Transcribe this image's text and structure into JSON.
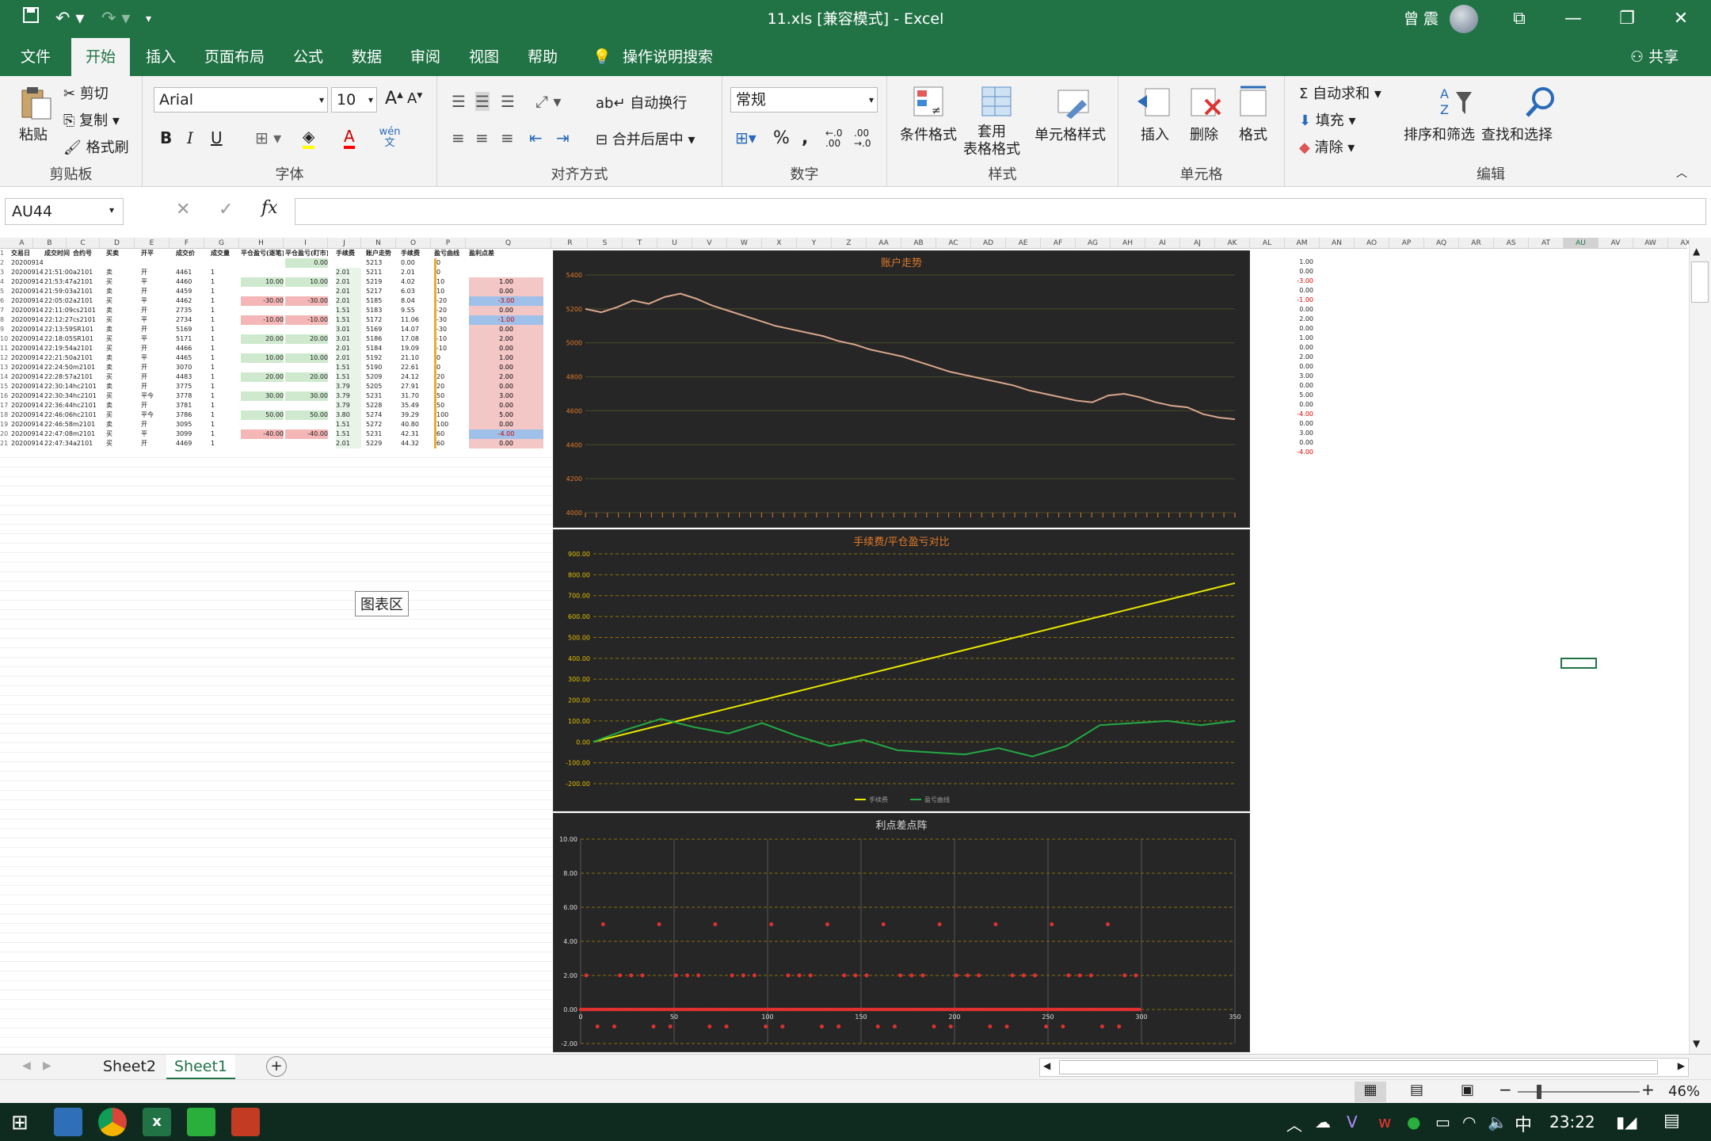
{
  "titlebar": {
    "title": "11.xls  [兼容模式]  -  Excel",
    "user_name": "曾 震",
    "share_label": "共享"
  },
  "tabs": [
    "文件",
    "开始",
    "插入",
    "页面布局",
    "公式",
    "数据",
    "审阅",
    "视图",
    "帮助"
  ],
  "tell_me": "操作说明搜索",
  "ribbon": {
    "clipboard": {
      "paste": "粘贴",
      "cut": "剪切",
      "copy": "复制",
      "format_painter": "格式刷",
      "label": "剪贴板"
    },
    "font": {
      "name": "Arial",
      "size": "10",
      "bold": "B",
      "italic": "I",
      "underline": "U",
      "label": "字体",
      "phonetic": "wén 文"
    },
    "alignment": {
      "wrap": "自动换行",
      "merge": "合并后居中",
      "label": "对齐方式"
    },
    "number": {
      "format": "常规",
      "percent": "%",
      "comma": ",",
      "inc": "←.0 .00",
      "dec": ".00 →.0",
      "label": "数字"
    },
    "styles": {
      "conditional": "条件格式",
      "table": "套用\n表格格式",
      "cell_styles": "单元格样式",
      "label": "样式"
    },
    "cells": {
      "insert": "插入",
      "delete": "删除",
      "format": "格式",
      "label": "单元格"
    },
    "editing": {
      "autosum": "自动求和",
      "fill": "填充",
      "clear": "清除",
      "sort": "排序和筛选",
      "find": "查找和选择",
      "label": "编辑"
    }
  },
  "formula_bar": {
    "name_box": "AU44",
    "fx": "fx",
    "content": ""
  },
  "tooltip": "图表区",
  "columns_left": [
    "A",
    "B",
    "C",
    "D",
    "E",
    "F",
    "G",
    "H",
    "I",
    "J",
    "N",
    "O",
    "P",
    "Q"
  ],
  "columns_right": [
    "R",
    "S",
    "T",
    "U",
    "V",
    "W",
    "X",
    "Y",
    "Z",
    "AA",
    "AB",
    "AC",
    "AD",
    "AE",
    "AF",
    "AG",
    "AH",
    "AI",
    "AJ",
    "AK",
    "AL",
    "AM",
    "AN",
    "AO",
    "AP",
    "AQ",
    "AR",
    "AS",
    "AT",
    "AU",
    "AV",
    "AW",
    "AX"
  ],
  "header_row": [
    "交易日",
    "成交时间",
    "合约号",
    "买卖",
    "开平",
    "成交价",
    "成交量",
    "平仓盈亏(逐笔)",
    "平仓盈亏(盯市)",
    "手续费",
    "账户走势",
    "手续费",
    "盈亏曲线",
    "盈利点差"
  ],
  "rows": [
    [
      "20200914",
      "",
      "",
      "",
      "",
      "",
      "",
      "",
      "0.00",
      "",
      "5213",
      "0.00",
      "0",
      ""
    ],
    [
      "20200914",
      "21:51:00",
      "a2101",
      "卖",
      "开",
      "4461",
      "1",
      "",
      "",
      "2.01",
      "5211",
      "2.01",
      "0",
      ""
    ],
    [
      "20200914",
      "21:53:47",
      "a2101",
      "买",
      "平",
      "4460",
      "1",
      "10.00",
      "10.00",
      "2.01",
      "5219",
      "4.02",
      "10",
      "1.00"
    ],
    [
      "20200914",
      "21:59:03",
      "a2101",
      "卖",
      "开",
      "4459",
      "1",
      "",
      "",
      "2.01",
      "5217",
      "6.03",
      "10",
      "0.00"
    ],
    [
      "20200914",
      "22:05:02",
      "a2101",
      "买",
      "平",
      "4462",
      "1",
      "-30.00",
      "-30.00",
      "2.01",
      "5185",
      "8.04",
      "-20",
      "-3.00"
    ],
    [
      "20200914",
      "22:11:09",
      "cs2101",
      "卖",
      "开",
      "2735",
      "1",
      "",
      "",
      "1.51",
      "5183",
      "9.55",
      "-20",
      "0.00"
    ],
    [
      "20200914",
      "22:12:27",
      "cs2101",
      "买",
      "平",
      "2734",
      "1",
      "-10.00",
      "-10.00",
      "1.51",
      "5172",
      "11.06",
      "-30",
      "-1.00"
    ],
    [
      "20200914",
      "22:13:59",
      "SR101",
      "卖",
      "开",
      "5169",
      "1",
      "",
      "",
      "3.01",
      "5169",
      "14.07",
      "-30",
      "0.00"
    ],
    [
      "20200914",
      "22:18:05",
      "SR101",
      "买",
      "平",
      "5171",
      "1",
      "20.00",
      "20.00",
      "3.01",
      "5186",
      "17.08",
      "-10",
      "2.00"
    ],
    [
      "20200914",
      "22:19:54",
      "a2101",
      "买",
      "开",
      "4466",
      "1",
      "",
      "",
      "2.01",
      "5184",
      "19.09",
      "-10",
      "0.00"
    ],
    [
      "20200914",
      "22:21:50",
      "a2101",
      "卖",
      "平",
      "4465",
      "1",
      "10.00",
      "10.00",
      "2.01",
      "5192",
      "21.10",
      "0",
      "1.00"
    ],
    [
      "20200914",
      "22:24:50",
      "m2101",
      "卖",
      "开",
      "3070",
      "1",
      "",
      "",
      "1.51",
      "5190",
      "22.61",
      "0",
      "0.00"
    ],
    [
      "20200914",
      "22:28:57",
      "a2101",
      "买",
      "开",
      "4483",
      "1",
      "20.00",
      "20.00",
      "1.51",
      "5209",
      "24.12",
      "20",
      "2.00"
    ],
    [
      "20200914",
      "22:30:14",
      "hc2101",
      "卖",
      "开",
      "3775",
      "1",
      "",
      "",
      "3.79",
      "5205",
      "27.91",
      "20",
      "0.00"
    ],
    [
      "20200914",
      "22:30:34",
      "hc2101",
      "买",
      "平今",
      "3778",
      "1",
      "30.00",
      "30.00",
      "3.79",
      "5231",
      "31.70",
      "50",
      "3.00"
    ],
    [
      "20200914",
      "22:36:44",
      "hc2101",
      "卖",
      "开",
      "3781",
      "1",
      "",
      "",
      "3.79",
      "5228",
      "35.49",
      "50",
      "0.00"
    ],
    [
      "20200914",
      "22:46:06",
      "hc2101",
      "买",
      "平今",
      "3786",
      "1",
      "50.00",
      "50.00",
      "3.80",
      "5274",
      "39.29",
      "100",
      "5.00"
    ],
    [
      "20200914",
      "22:46:58",
      "m2101",
      "卖",
      "开",
      "3095",
      "1",
      "",
      "",
      "1.51",
      "5272",
      "40.80",
      "100",
      "0.00"
    ],
    [
      "20200914",
      "22:47:08",
      "m2101",
      "买",
      "平",
      "3099",
      "1",
      "-40.00",
      "-40.00",
      "1.51",
      "5231",
      "42.31",
      "60",
      "-4.00"
    ],
    [
      "20200914",
      "22:47:34",
      "a2101",
      "买",
      "开",
      "4469",
      "1",
      "",
      "",
      "2.01",
      "5229",
      "44.32",
      "60",
      "0.00"
    ]
  ],
  "right_col_AM": [
    "1.00",
    "0.00",
    "-3.00",
    "0.00",
    "-1.00",
    "0.00",
    "2.00",
    "0.00",
    "1.00",
    "0.00",
    "2.00",
    "0.00",
    "3.00",
    "0.00",
    "5.00",
    "0.00",
    "-4.00",
    "0.00",
    "3.00",
    "0.00",
    "-4.00"
  ],
  "charts": [
    {
      "title": "账户走势"
    },
    {
      "title": "手续费/平仓盈亏对比"
    },
    {
      "title": "利点差点阵"
    }
  ],
  "chart_data": [
    {
      "type": "line",
      "title": "账户走势",
      "y_ticks": [
        "5400",
        "5200",
        "5000",
        "4800",
        "4600",
        "4400",
        "4200",
        "4000"
      ],
      "ylim": [
        4000,
        5400
      ],
      "series": [
        {
          "values": [
            5200,
            5180,
            5210,
            5250,
            5230,
            5270,
            5290,
            5260,
            5220,
            5190,
            5160,
            5130,
            5100,
            5080,
            5060,
            5040,
            5010,
            4990,
            4960,
            4940,
            4920,
            4890,
            4860,
            4830,
            4810,
            4790,
            4770,
            4750,
            4720,
            4700,
            4680,
            4660,
            4650,
            4690,
            4700,
            4680,
            4650,
            4630,
            4620,
            4580,
            4560,
            4550
          ]
        }
      ]
    },
    {
      "type": "line",
      "title": "手续费/平仓盈亏对比",
      "y_ticks": [
        "900.00",
        "800.00",
        "700.00",
        "600.00",
        "500.00",
        "400.00",
        "300.00",
        "200.00",
        "100.00",
        "0.00",
        "-100.00",
        "-200.00"
      ],
      "ylim": [
        -200,
        900
      ],
      "series": [
        {
          "name": "手续费",
          "values": [
            0,
            40,
            80,
            120,
            160,
            200,
            240,
            280,
            320,
            360,
            400,
            440,
            480,
            520,
            560,
            600,
            640,
            680,
            720,
            760
          ]
        },
        {
          "name": "盈亏曲线",
          "values": [
            0,
            60,
            110,
            70,
            40,
            90,
            30,
            -20,
            10,
            -40,
            -50,
            -60,
            -30,
            -70,
            -20,
            80,
            90,
            100,
            80,
            100
          ]
        }
      ]
    },
    {
      "type": "scatter",
      "title": "利点差点阵",
      "y_ticks": [
        "10.00",
        "8.00",
        "6.00",
        "4.00",
        "2.00",
        "0.00",
        "-2.00"
      ],
      "x_ticks": [
        "0",
        "50",
        "100",
        "150",
        "200",
        "250",
        "300",
        "350"
      ],
      "ylim": [
        -2,
        10
      ]
    }
  ],
  "sheet_tabs": [
    "Sheet2",
    "Sheet1"
  ],
  "status": {
    "zoom": "46%"
  },
  "taskbar": {
    "time": "23:22",
    "ime": "中"
  }
}
